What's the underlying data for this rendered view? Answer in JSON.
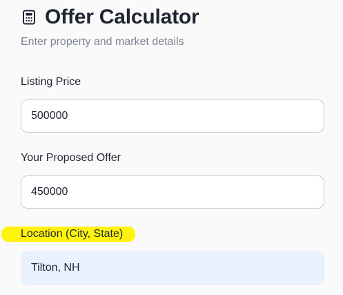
{
  "header": {
    "icon": "calculator-icon",
    "title": "Offer Calculator",
    "subtitle": "Enter property and market details"
  },
  "form": {
    "listing_price": {
      "label": "Listing Price",
      "value": "500000"
    },
    "proposed_offer": {
      "label": "Your Proposed Offer",
      "value": "450000"
    },
    "location": {
      "label": "Location (City, State)",
      "value": "Tilton, NH"
    }
  },
  "colors": {
    "highlight": "#fff200",
    "location_field_bg": "#e9f0fe",
    "subtitle": "#7c8391"
  }
}
